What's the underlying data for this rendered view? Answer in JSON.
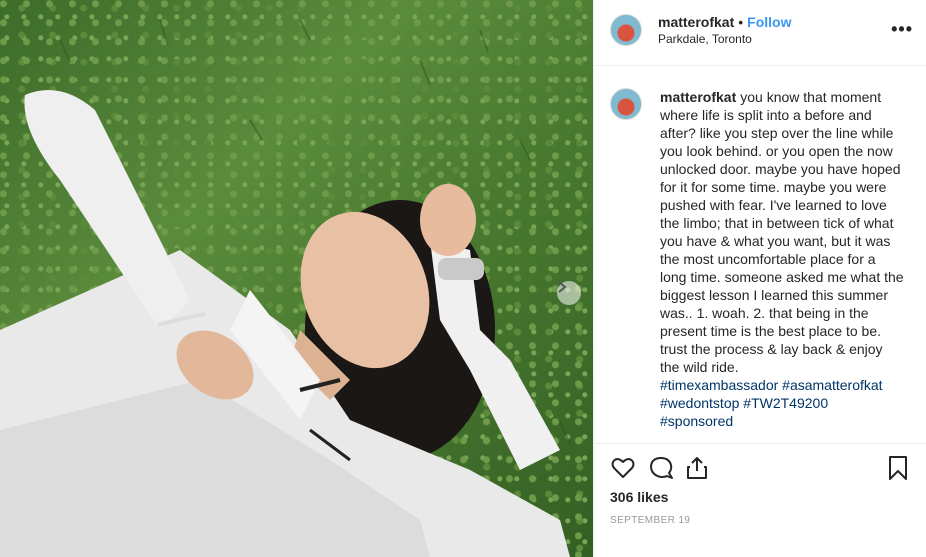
{
  "post": {
    "username": "matterofkat",
    "separator": "•",
    "follow_label": "Follow",
    "location": "Parkdale, Toronto",
    "more_label": "•••",
    "caption_lines": [
      "you know that moment",
      "where life is split into a before and",
      "after? like you step over the line while",
      "you look behind. or you open the now",
      "unlocked door. maybe you have hoped",
      "for it for some time. maybe you were",
      "pushed with fear. I've learned to love",
      "the limbo; that in between tick of what",
      "you have & what you want, but it was",
      "the most uncomfortable place for a",
      "long time. someone asked me what the",
      "biggest lesson I learned this summer",
      "was.. 1. woah. 2. that being in the",
      "present time is the best place to be.",
      "trust the process & lay back & enjoy",
      "the wild ride."
    ],
    "hashtag_lines": [
      "#timexambassador #asamatterofkat",
      "#wedontstop #TW2T49200",
      "#sponsored"
    ],
    "likes": "306 likes",
    "date": "SEPTEMBER 19"
  },
  "icons": {
    "like": "heart-icon",
    "comment": "comment-icon",
    "share": "share-icon",
    "save": "bookmark-icon",
    "next": "chevron-right-icon"
  },
  "colors": {
    "link": "#3897f0",
    "hashtag": "#003569",
    "text": "#262626",
    "muted": "#999999"
  }
}
